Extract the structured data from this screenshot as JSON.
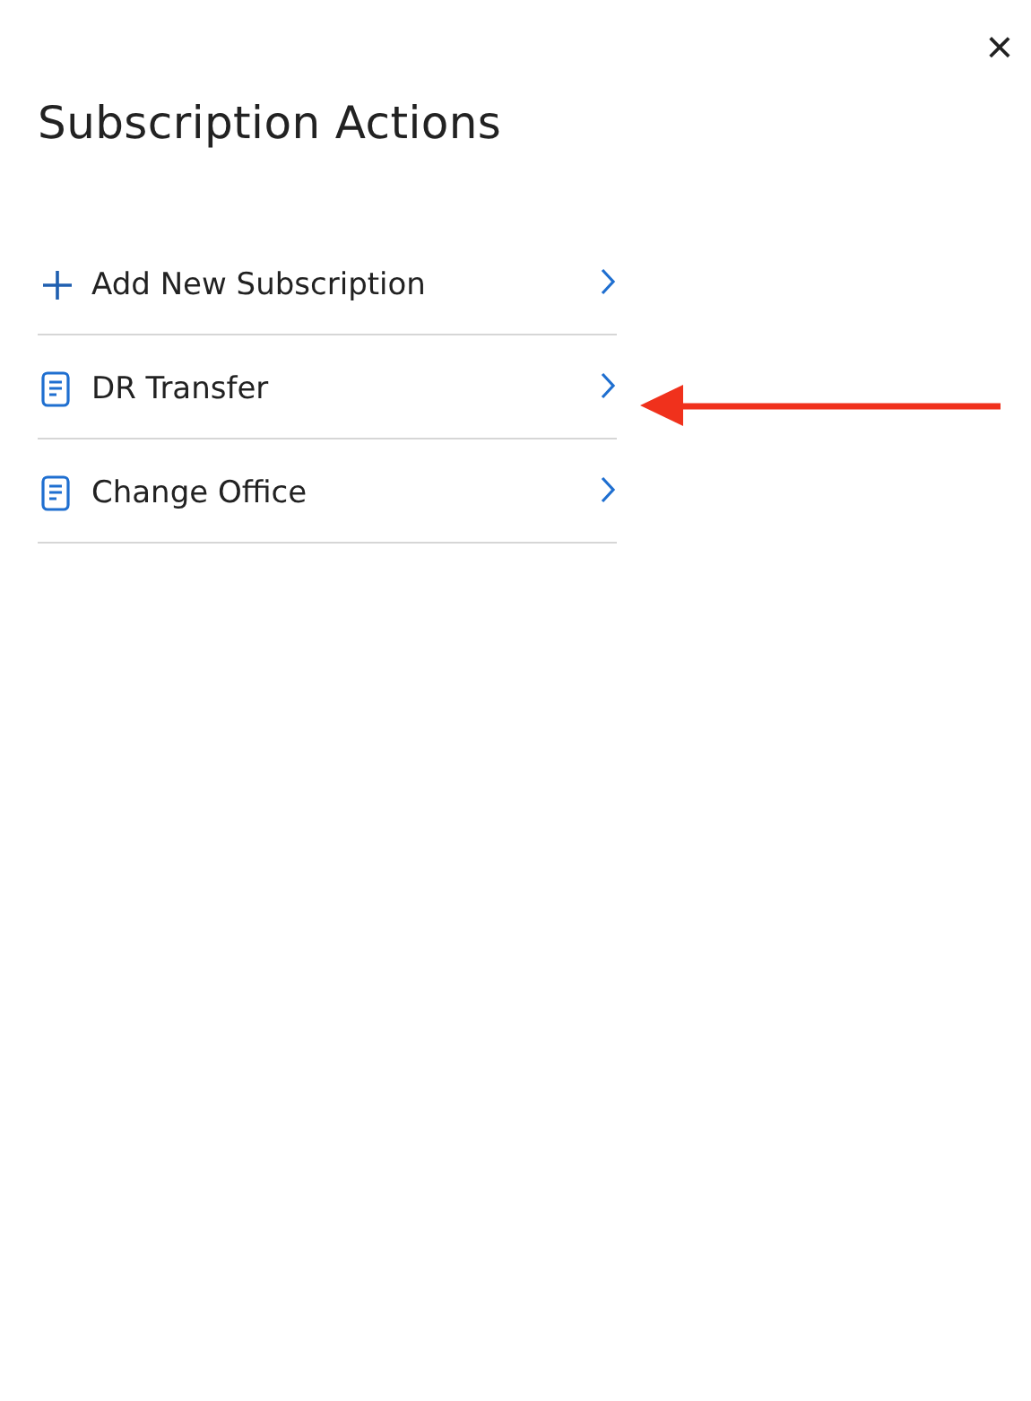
{
  "title": "Subscription Actions",
  "close": {
    "label": "×"
  },
  "items": [
    {
      "kind": "add",
      "label": "Add New Subscription"
    },
    {
      "kind": "document",
      "label": "DR Transfer"
    },
    {
      "kind": "document",
      "label": "Change Office"
    }
  ],
  "annotations": [
    {
      "kind": "arrow"
    }
  ]
}
